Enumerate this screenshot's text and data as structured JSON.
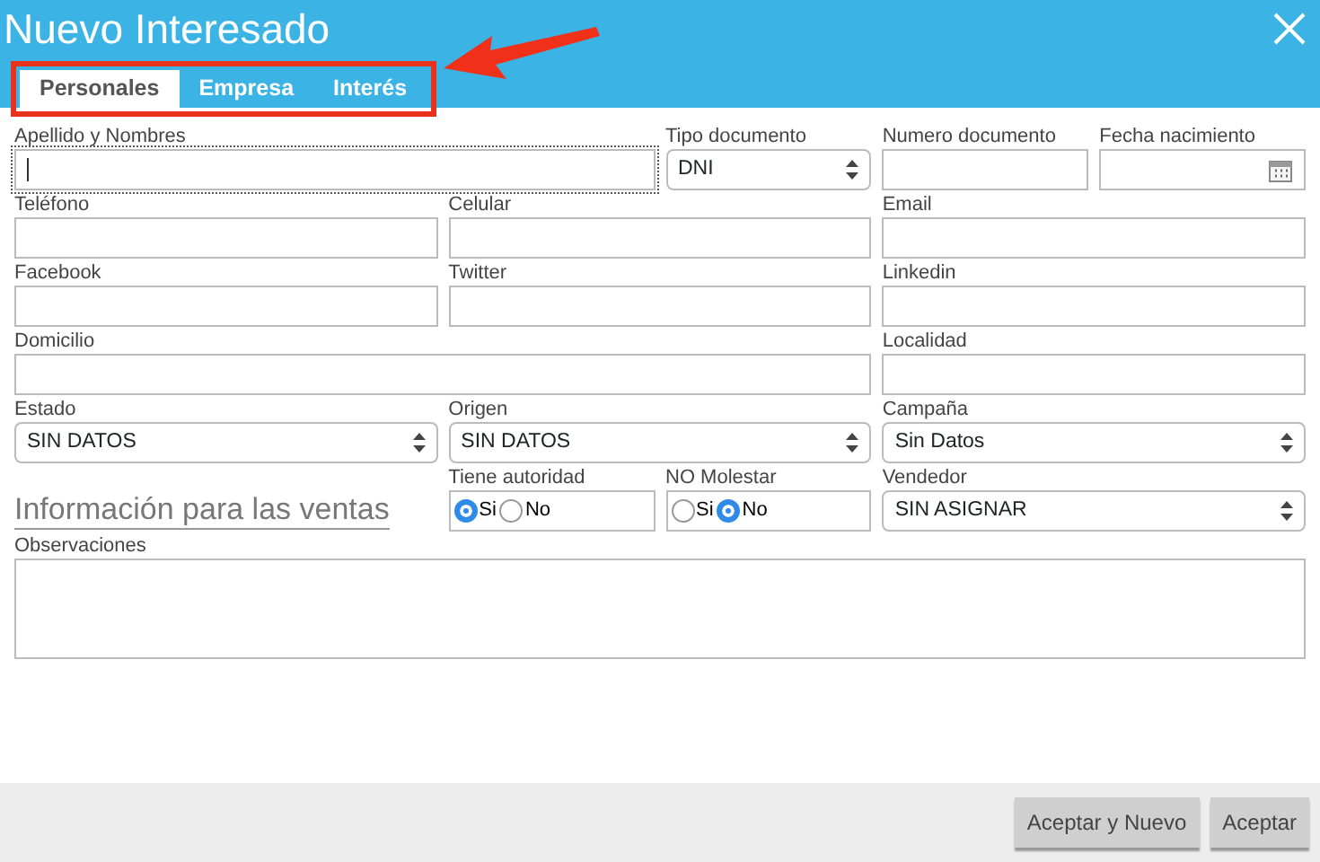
{
  "window": {
    "title": "Nuevo Interesado"
  },
  "tabs": [
    {
      "label": "Personales",
      "selected": true
    },
    {
      "label": "Empresa",
      "selected": false
    },
    {
      "label": "Interés",
      "selected": false
    }
  ],
  "fields": [
    {
      "kind": "text",
      "label": "Apellido y Nombres",
      "focused": true
    },
    {
      "kind": "select",
      "label": "Tipo documento",
      "value": "DNI"
    },
    {
      "kind": "text",
      "label": "Numero documento"
    },
    {
      "kind": "date",
      "label": "Fecha nacimiento"
    },
    {
      "kind": "text",
      "label": "Teléfono"
    },
    {
      "kind": "text",
      "label": "Celular"
    },
    {
      "kind": "text",
      "label": "Email"
    },
    {
      "kind": "text",
      "label": "Facebook"
    },
    {
      "kind": "text",
      "label": "Twitter"
    },
    {
      "kind": "text",
      "label": "Linkedin"
    },
    {
      "kind": "text",
      "label": "Domicilio"
    },
    {
      "kind": "text",
      "label": "Localidad"
    },
    {
      "kind": "select",
      "label": "Estado",
      "value": "SIN DATOS"
    },
    {
      "kind": "select",
      "label": "Origen",
      "value": "SIN DATOS"
    },
    {
      "kind": "select",
      "label": "Campaña",
      "value": "Sin Datos"
    },
    {
      "kind": "heading",
      "label": "Información para las ventas"
    },
    {
      "kind": "radio",
      "label": "Tiene autoridad",
      "options": [
        {
          "label": "Si",
          "selected": true
        },
        {
          "label": "No",
          "selected": false
        }
      ]
    },
    {
      "kind": "radio",
      "label": "NO Molestar",
      "options": [
        {
          "label": "Si",
          "selected": false
        },
        {
          "label": "No",
          "selected": true
        }
      ]
    },
    {
      "kind": "select",
      "label": "Vendedor",
      "value": "SIN ASIGNAR"
    },
    {
      "kind": "textarea",
      "label": "Observaciones"
    }
  ],
  "buttons": [
    "Aceptar y Nuevo",
    "Aceptar"
  ]
}
